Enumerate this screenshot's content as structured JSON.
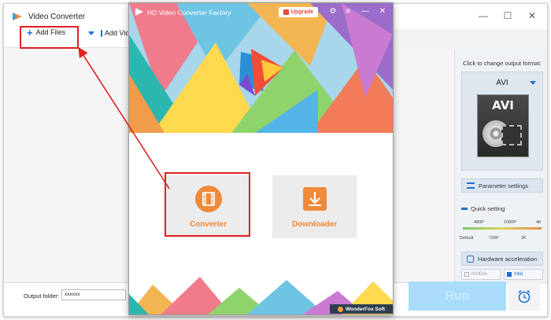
{
  "bg_window": {
    "title": "Video Converter",
    "icon": "video-converter-app-icon",
    "controls": [
      "—",
      "☐",
      "✕"
    ],
    "toolbar": {
      "add_files": "Add Files",
      "add_video_folder": "Add Video Folder"
    },
    "output_panel": {
      "hint": "Click to change output format:",
      "format": "AVI",
      "thumb_label": "AVI",
      "parameter_settings": "Parameter settings",
      "quick_setting": "Quick setting",
      "ticks_top": [
        "480P",
        "1080P",
        "4K"
      ],
      "ticks_bottom": [
        "Default",
        "720P",
        "2K"
      ],
      "hardware_acceleration": "Hardware acceleration",
      "gpu_options": [
        {
          "label": "NVIDIA",
          "selected": false
        },
        {
          "label": "Intel",
          "selected": true
        }
      ]
    },
    "footer": {
      "output_folder_label": "Output folder:",
      "output_folder_value": "xxxxxx",
      "run": "Run"
    }
  },
  "fg_window": {
    "title": "HD Video Converter Factory",
    "upgrade": "Upgrade",
    "controls": [
      "⚙",
      "≡",
      "—",
      "✕"
    ],
    "modules": {
      "converter": "Converter",
      "downloader": "Downloader"
    },
    "brand": "WonderFox Soft"
  },
  "colors": {
    "accent": "#1c70d0",
    "orange": "#ef8a3a",
    "highlight": "#e02020",
    "run_button": "#a9dcfb"
  }
}
